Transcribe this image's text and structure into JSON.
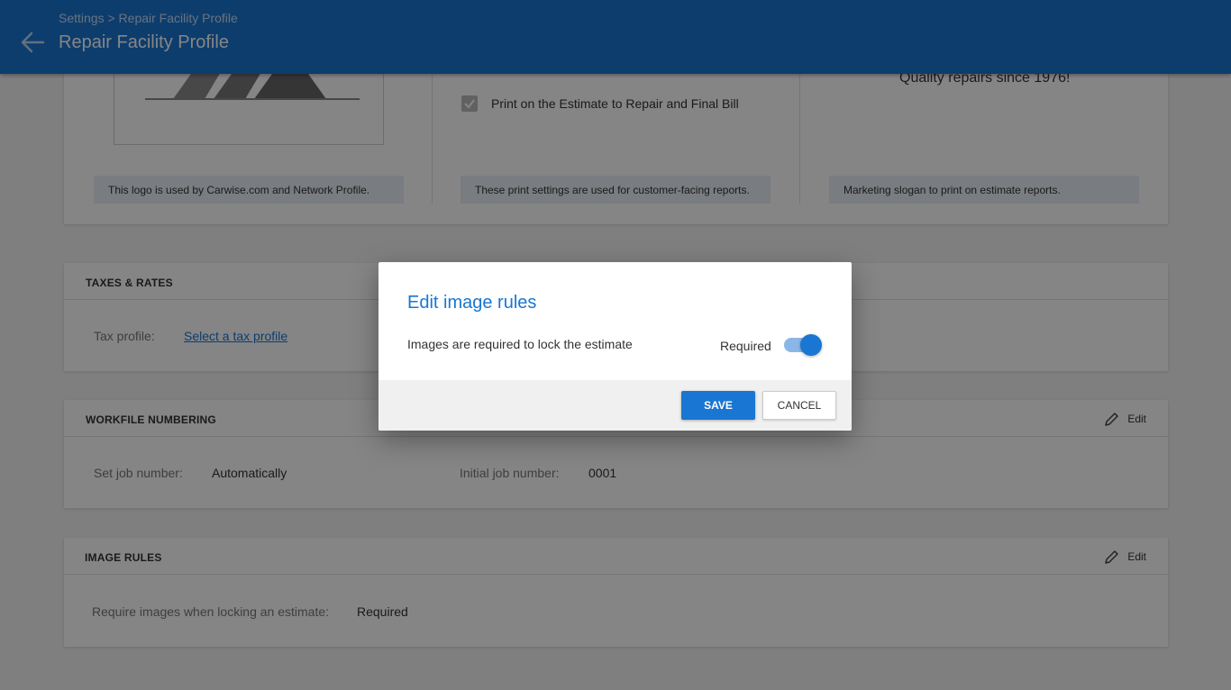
{
  "header": {
    "breadcrumb": "Settings > Repair Facility Profile",
    "title": "Repair Facility Profile",
    "back_icon": "arrow-left-icon"
  },
  "profile_top": {
    "logo_note": "This logo is used by Carwise.com and Network Profile.",
    "print_checkbox_label": "Print on the Estimate to Repair and Final Bill",
    "print_note": "These print settings are used for customer-facing reports.",
    "slogan": "Quality repairs since 1976!",
    "slogan_note": "Marketing slogan to print on estimate reports."
  },
  "taxes": {
    "title": "TAXES & RATES",
    "tax_profile_label": "Tax profile:",
    "tax_profile_link": "Select a tax profile"
  },
  "workfile": {
    "title": "WORKFILE NUMBERING",
    "edit_label": "Edit",
    "set_job_label": "Set job number:",
    "set_job_value": "Automatically",
    "initial_job_label": "Initial job number:",
    "initial_job_value": "0001"
  },
  "image_rules": {
    "title": "IMAGE RULES",
    "edit_label": "Edit",
    "require_label": "Require images when locking an estimate:",
    "require_value": "Required"
  },
  "dialog": {
    "title": "Edit image rules",
    "description": "Images are required to lock the estimate",
    "toggle_label": "Required",
    "toggle_on": true,
    "save_label": "SAVE",
    "cancel_label": "CANCEL"
  },
  "colors": {
    "primary": "#1976d2",
    "toggle_track": "#8bb7e8"
  }
}
